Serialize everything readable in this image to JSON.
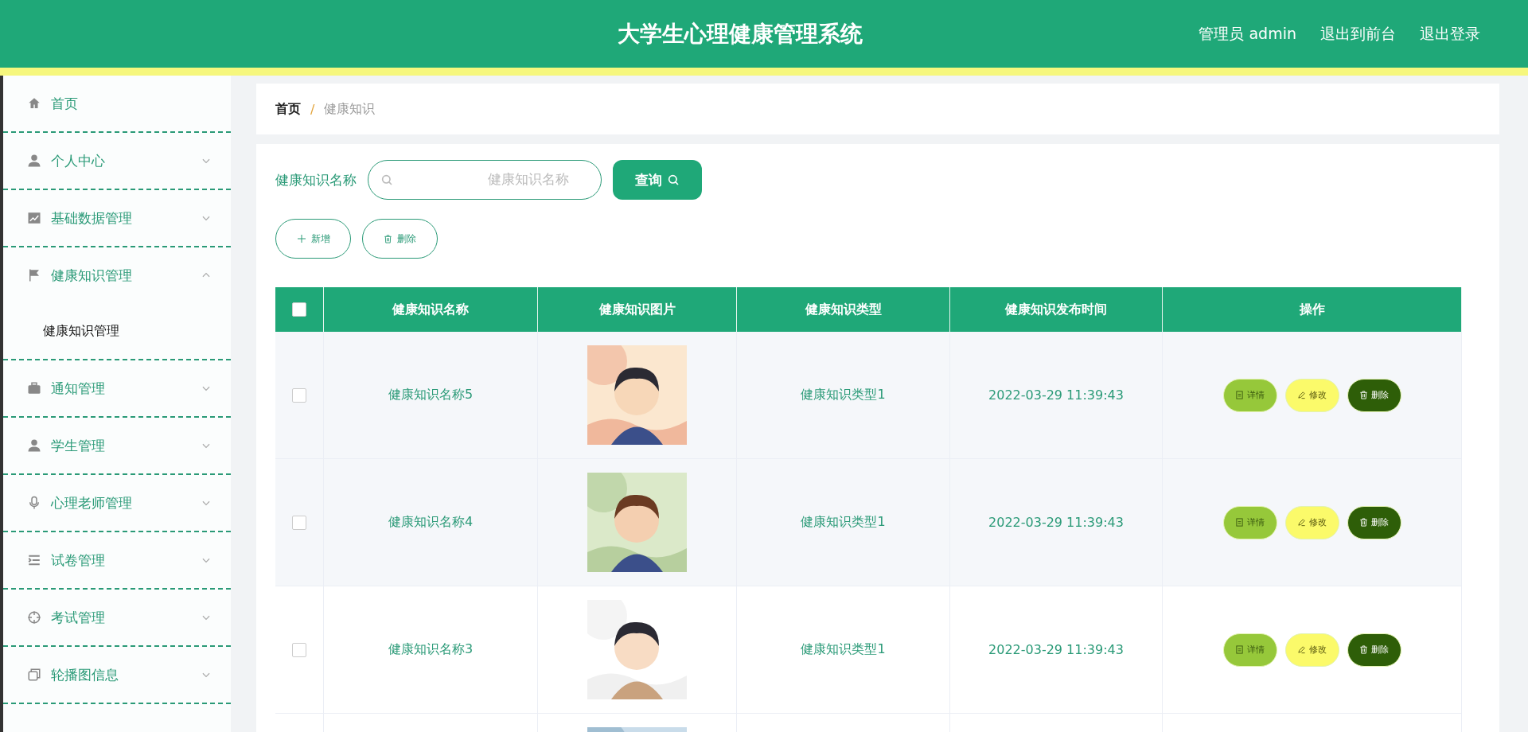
{
  "header": {
    "title": "大学生心理健康管理系统",
    "links": [
      "管理员 admin",
      "退出到前台",
      "退出登录"
    ]
  },
  "sidebar": {
    "items": [
      {
        "label": "首页"
      },
      {
        "label": "个人中心",
        "expanded": false
      },
      {
        "label": "基础数据管理",
        "expanded": false
      },
      {
        "label": "健康知识管理",
        "expanded": true,
        "children": [
          {
            "label": "健康知识管理"
          }
        ]
      },
      {
        "label": "通知管理",
        "expanded": false
      },
      {
        "label": "学生管理",
        "expanded": false
      },
      {
        "label": "心理老师管理",
        "expanded": false
      },
      {
        "label": "试卷管理",
        "expanded": false
      },
      {
        "label": "考试管理",
        "expanded": false
      },
      {
        "label": "轮播图信息",
        "expanded": false
      }
    ]
  },
  "breadcrumb": [
    "首页",
    "健康知识"
  ],
  "breadcrumb_separator": "/",
  "search": {
    "label": "健康知识名称",
    "placeholder": "健康知识名称",
    "button": "查询"
  },
  "actions": [
    "新增",
    "删除"
  ],
  "table": {
    "header_checked": false,
    "columns": [
      "健康知识名称",
      "健康知识图片",
      "健康知识类型",
      "健康知识发布时间",
      "操作"
    ],
    "rows": [
      {
        "checked": false,
        "name": "健康知识名称5",
        "image": {
          "kind": "picture"
        },
        "type": "健康知识类型1",
        "time": "2022-03-29 11:39:43",
        "buttons": [
          "详情",
          "修改",
          "删除"
        ]
      },
      {
        "checked": false,
        "name": "健康知识名称4",
        "image": {
          "kind": "picture"
        },
        "type": "健康知识类型1",
        "time": "2022-03-29 11:39:43",
        "buttons": [
          "详情",
          "修改",
          "删除"
        ]
      },
      {
        "checked": false,
        "name": "健康知识名称3",
        "image": {
          "kind": "picture"
        },
        "type": "健康知识类型1",
        "time": "2022-03-29 11:39:43",
        "buttons": [
          "详情",
          "修改",
          "删除"
        ]
      },
      {
        "image": {
          "kind": "picture"
        }
      }
    ]
  }
}
